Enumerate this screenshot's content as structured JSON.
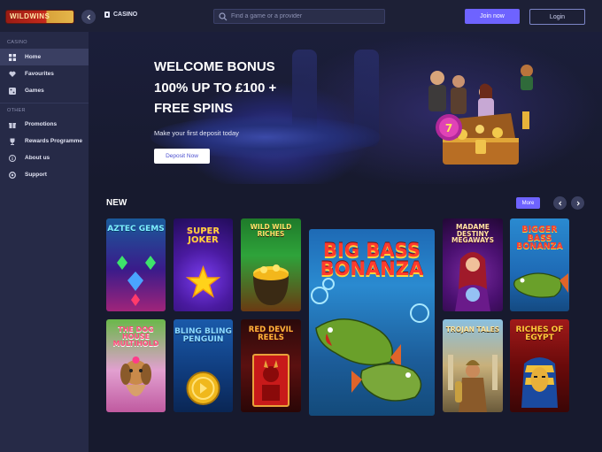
{
  "header": {
    "logo_text": "WILDWINS",
    "section_label": "CASINO",
    "search_placeholder": "Find a game or a provider",
    "join_label": "Join now",
    "login_label": "Login"
  },
  "sidebar": {
    "section_casino": "CASINO",
    "section_other": "OTHER",
    "items": [
      {
        "label": "Home",
        "icon": "home-icon"
      },
      {
        "label": "Favourites",
        "icon": "heart-icon"
      },
      {
        "label": "Games",
        "icon": "games-icon"
      }
    ],
    "other_items": [
      {
        "label": "Promotions",
        "icon": "gift-icon"
      },
      {
        "label": "Rewards Programme",
        "icon": "trophy-icon"
      },
      {
        "label": "About us",
        "icon": "info-icon"
      },
      {
        "label": "Support",
        "icon": "support-icon"
      }
    ]
  },
  "banner": {
    "title_line1": "WELCOME BONUS",
    "title_line2": "100% UP TO £100 +",
    "title_line3": "FREE SPINS",
    "subtitle": "Make your first deposit today",
    "cta_label": "Deposit Now"
  },
  "new_section": {
    "title": "NEW",
    "more_label": "More"
  },
  "games": [
    {
      "title": "AZTEC GEMS"
    },
    {
      "title": "SUPER JOKER"
    },
    {
      "title": "WILD WILD RICHES"
    },
    {
      "title": "BIG BASS BONANZA"
    },
    {
      "title": "MADAME DESTINY MEGAWAYS"
    },
    {
      "title": "BIGGER BASS BONANZA"
    },
    {
      "title": "THE DOG HOUSE MULTIHOLD"
    },
    {
      "title": "BLING BLING PENGUIN"
    },
    {
      "title": "RED DEVIL REELS"
    },
    {
      "title": "TROJAN TALES"
    },
    {
      "title": "RICHES OF EGYPT"
    }
  ],
  "colors": {
    "accent": "#6e63ff",
    "sidebar_bg": "#262a47",
    "page_bg": "#171a2e"
  }
}
